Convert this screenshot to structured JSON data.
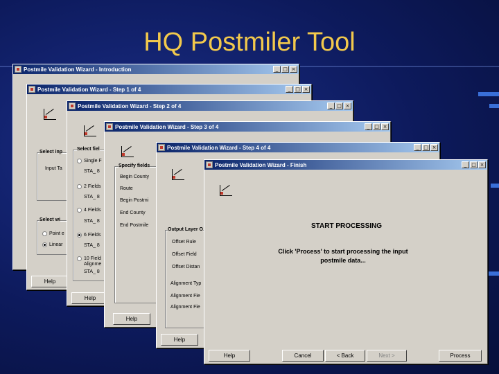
{
  "slide": {
    "title": "HQ Postmiler Tool"
  },
  "colors": {
    "title": "#f2c94c",
    "background": "#0d1a5c",
    "titlebar_start": "#0a246a",
    "titlebar_end": "#a6caf0",
    "window": "#d4d0c8"
  },
  "window_controls": {
    "minimize": "_",
    "maximize": "□",
    "close": "×"
  },
  "windows": [
    {
      "title": "Postmile Validation Wizard - Introduction"
    },
    {
      "title": "Postmile Validation Wizard - Step 1 of 4"
    },
    {
      "title": "Postmile Validation Wizard - Step 2 of 4"
    },
    {
      "title": "Postmile Validation Wizard - Step 3 of 4"
    },
    {
      "title": "Postmile Validation Wizard - Step 4 of 4"
    },
    {
      "title": "Postmile Validation Wizard - Finish"
    }
  ],
  "step1": {
    "group_input": "Select inp",
    "input_label": "Input Ta",
    "group_select": "Select wi",
    "radio_point": "Point e",
    "radio_linear": "Linear",
    "help": "Help"
  },
  "step2": {
    "group_fields": "Select fiel",
    "opt_single": "Single F",
    "sub_single": "STA_ 8",
    "opt_2": "2 Fields",
    "sub_2": "STA_ 8",
    "opt_4": "4 Fields",
    "sub_4": "STA_ 8",
    "opt_6": "6 Fields",
    "sub_6": "STA_ 8",
    "opt_10": "10 Field",
    "opt_10b": "Alignme",
    "sub_10": "STA_ 8",
    "help": "Help"
  },
  "step3": {
    "group": "Specify fields",
    "begin_county": "Begin County",
    "route": "Route",
    "begin_postmile": "Begin Postmi",
    "end_county": "End County",
    "end_postmile": "End Postmile",
    "help": "Help"
  },
  "step4": {
    "group": "Output Layer O",
    "offset_rule": "Offset Rule",
    "offset_field": "Offset Field",
    "offset_distance": "Offset Distan",
    "alignment_type": "Alignment Typ",
    "alignment_field": "Alignment Fie",
    "alignment_field2": "Alignment Fie",
    "help": "Help"
  },
  "finish": {
    "heading": "START PROCESSING",
    "message_line1": "Click 'Process' to start processing the input",
    "message_line2": "postmile data...",
    "help": "Help",
    "cancel": "Cancel",
    "back": "< Back",
    "next": "Next >",
    "process": "Process"
  }
}
